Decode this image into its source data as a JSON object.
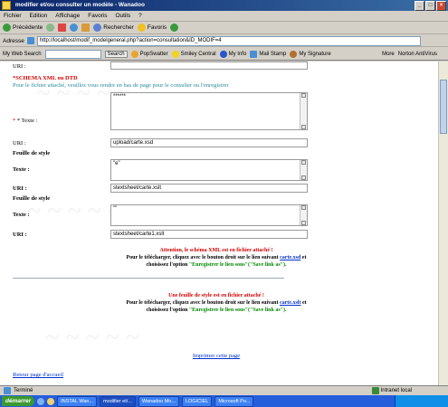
{
  "window": {
    "title": "modifier et/ou consulter un modèle - Wanadoo"
  },
  "menu": [
    "Fichier",
    "Edition",
    "Affichage",
    "Favoris",
    "Outils",
    "?"
  ],
  "toolbar": {
    "back": "Précédente",
    "search": "Rechercher",
    "favorites": "Favoris"
  },
  "address": {
    "label": "Adresse",
    "url": "http://localhost/modif_modelgeneral.php?action=consultation&ID_MODIF=4"
  },
  "linksbar": {
    "search_label": "My Web Search",
    "search_btn": "Search",
    "items": [
      "PopSwatter",
      "Smiley Central",
      "My Info",
      "Mail Stamp",
      "My Signature"
    ],
    "more": "More",
    "norton": "Norton AntiVirus"
  },
  "form": {
    "uri1_label": "URI :",
    "schema_title": "*SCHEMA XML ou DTD",
    "schema_note": "Pour le fichier attaché, veuillez vous rendre en bas de page pour le consulter ou l'enregistrer",
    "texte_label": "* Texte :",
    "texte_value": "******",
    "uri2_label": "URI :",
    "uri2_value": "upload/carte.xsd",
    "feuille1_label": "Feuille de style",
    "texte2_label": "Texte :",
    "texte2_value": "\"e\"",
    "uri3_label": "URI :",
    "uri3_value": "stextsheet/carte.xslt",
    "feuille2_label": "Feuille de style",
    "texte3_label": "Texte :",
    "texte3_value": "\"\"",
    "uri4_label": "URI :",
    "uri4_value": "stextsheet/carte1.xslt"
  },
  "notice1": {
    "warning": "Attention, le schéma XML est en fichier attaché !",
    "line1": "Pour le télécharger, cliquez avec le bouton droit sur le lien suivant",
    "link": "carte.xsd",
    "line1_end": "et",
    "line2": "choisissez l'option",
    "option": "\"Enregistrer le lien sous\"(\"Save link as\")."
  },
  "notice2": {
    "warning": "Une feuille de style est en fichier attaché !",
    "line1": "Pour le télécharger, cliquez avec le bouton droit sur le lien suivant",
    "link": "carte.xslt",
    "line1_end": "et",
    "line2": "choisissez l'option",
    "option": "\"Enregistrer le lien sous\"(\"Save link as\")."
  },
  "print_link": "Imprimer cette page",
  "home_link": "Retour page d'accueil",
  "status": {
    "text": "Terminé",
    "zone": "Intranet local"
  },
  "taskbar": {
    "start": "démarrer",
    "tasks": [
      "INSTAL Wan...",
      "modifier et/...",
      "Wanadoo Mo...",
      "LOGICIEL",
      "Microsoft Po..."
    ],
    "active_index": 1
  }
}
